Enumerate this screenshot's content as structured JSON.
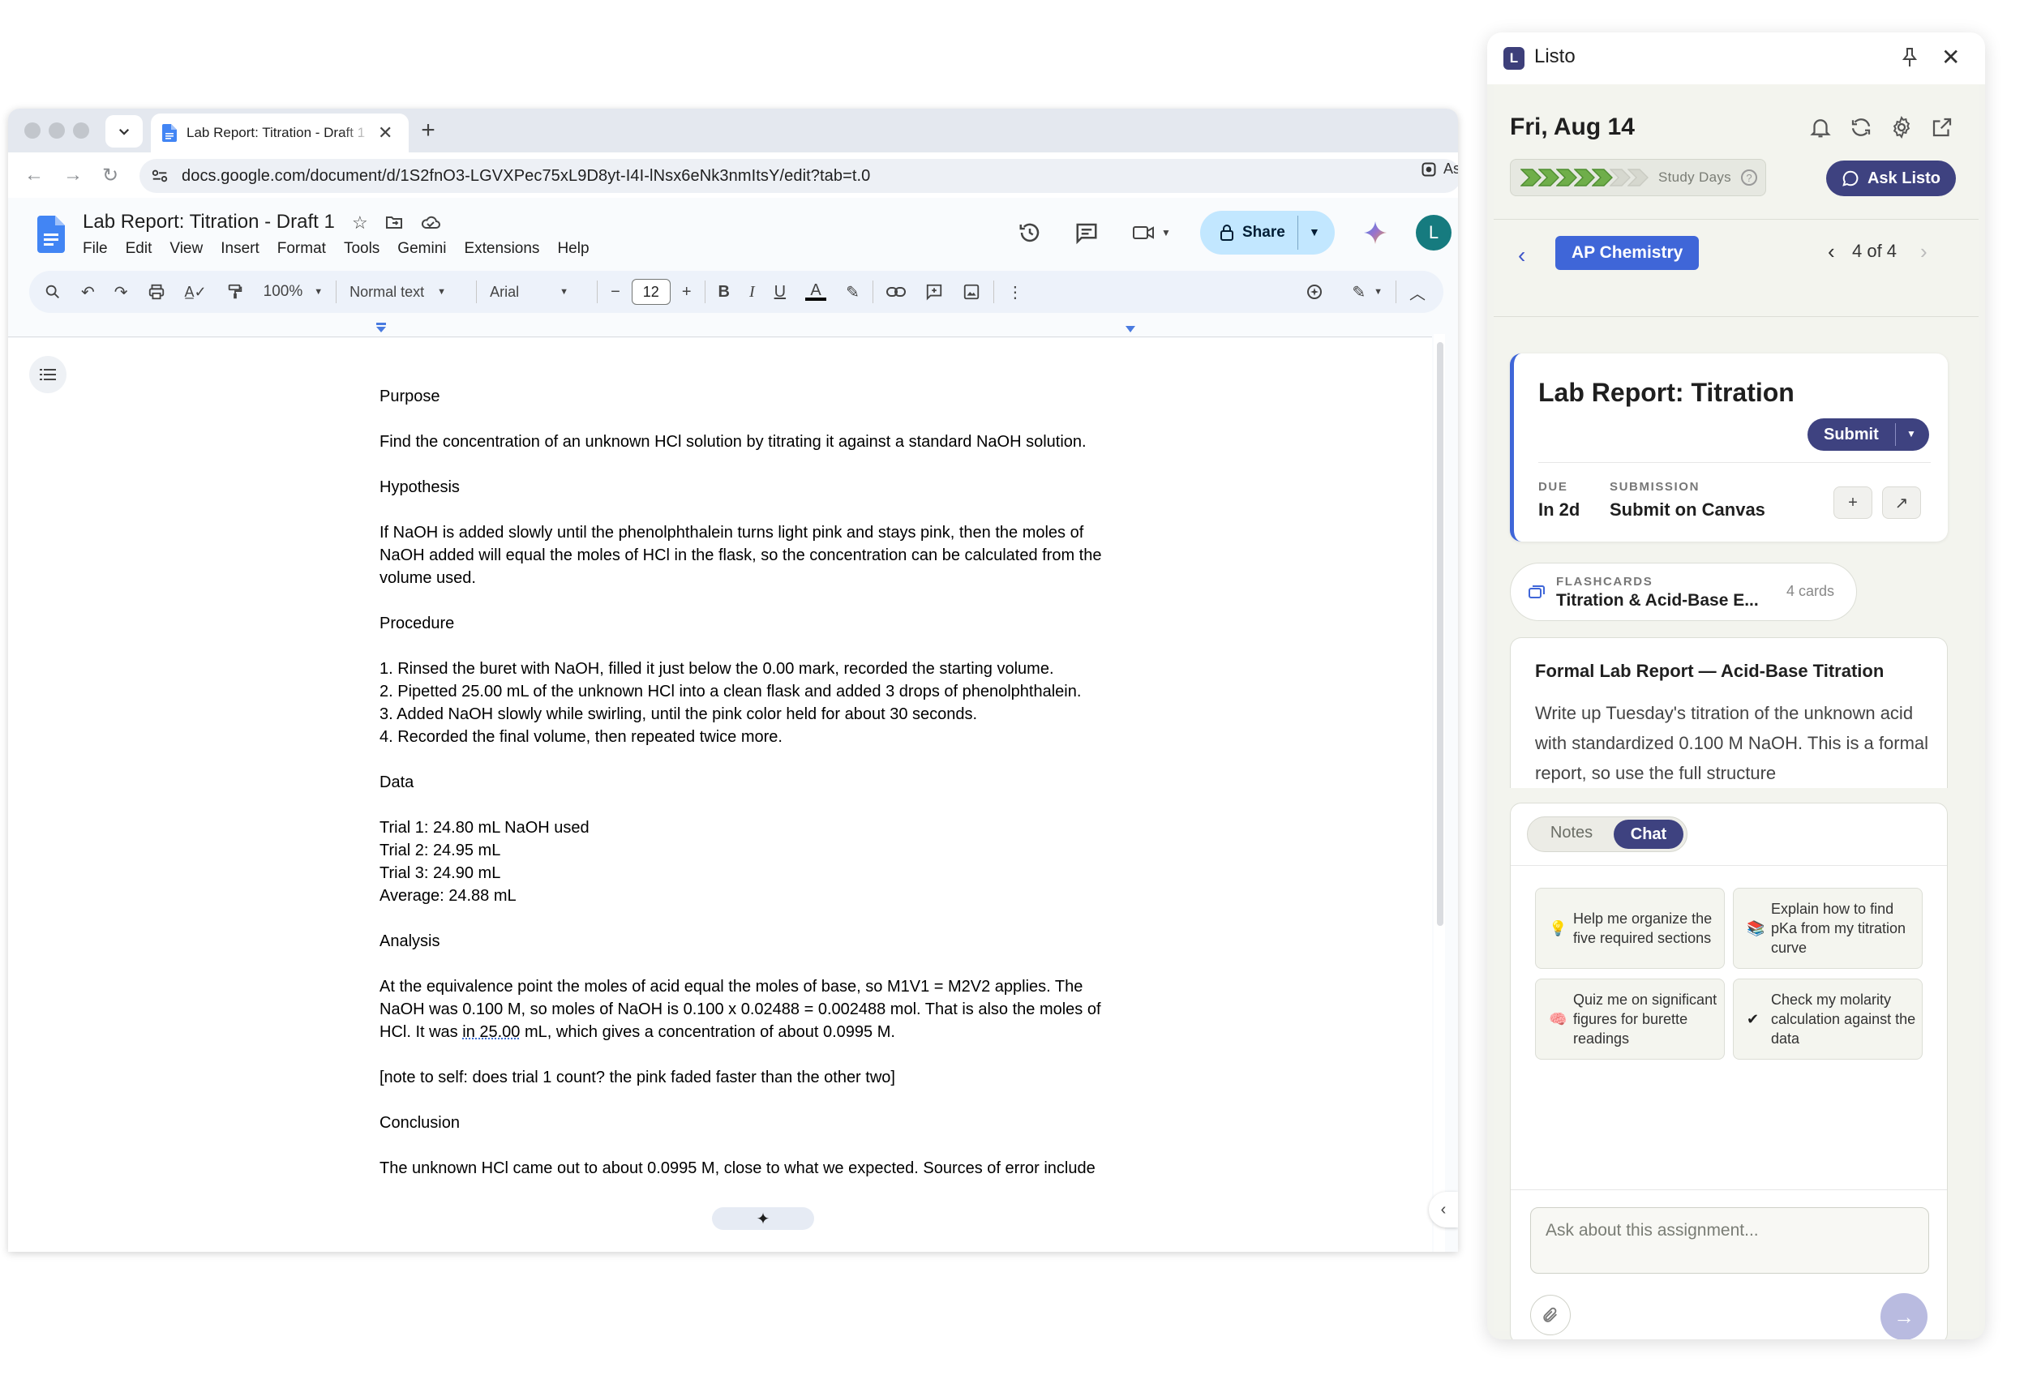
{
  "browser": {
    "tab_title": "Lab Report: Titration - Draft 1",
    "new_tab": "+",
    "url": "docs.google.com/document/d/1S2fnO3-LGVXPec75xL9D8yt-I4I-lNsx6eNk3nmItsY/edit?tab=t.0",
    "omnibox_extension": "As"
  },
  "docs": {
    "title": "Lab Report: Titration - Draft 1",
    "menu": [
      "File",
      "Edit",
      "View",
      "Insert",
      "Format",
      "Tools",
      "Gemini",
      "Extensions",
      "Help"
    ],
    "share_label": "Share",
    "avatar_letter": "L",
    "toolbar": {
      "zoom": "100%",
      "style": "Normal text",
      "font": "Arial",
      "font_size": "12"
    },
    "body": {
      "purpose_h": "Purpose",
      "purpose": "Find the concentration of an unknown HCl solution by titrating it against a standard NaOH solution.",
      "hypothesis_h": "Hypothesis",
      "hypothesis": "If NaOH is added slowly until the phenolphthalein turns light pink and stays pink, then the moles of NaOH added will equal the moles of HCl in the flask, so the concentration can be calculated from the volume used.",
      "procedure_h": "Procedure",
      "procedure": [
        "1. Rinsed the buret with NaOH, filled it just below the 0.00 mark, recorded the starting volume.",
        "2. Pipetted 25.00 mL of the unknown HCl into a clean flask and added 3 drops of phenolphthalein.",
        "3. Added NaOH slowly while swirling, until the pink color held for about 30 seconds.",
        "4. Recorded the final volume, then repeated twice more."
      ],
      "data_h": "Data",
      "data": [
        "Trial 1: 24.80 mL NaOH used",
        "Trial 2: 24.95 mL",
        "Trial 3: 24.90 mL",
        "Average: 24.88 mL"
      ],
      "analysis_h": "Analysis",
      "analysis_a": "At the equivalence point the moles of acid equal the moles of base, so M1V1 = M2V2 applies. The NaOH was 0.100 M, so moles of NaOH is 0.100 x 0.02488 = 0.002488 mol. That is also the moles of HCl. It was ",
      "analysis_underlined": "in 25.00",
      "analysis_b": " mL, which gives a concentration of about 0.0995 M.",
      "note": "[note to self: does trial 1 count? the pink faded faster than the other two]",
      "conclusion_h": "Conclusion",
      "conclusion": "The unknown HCl came out to about 0.0995 M, close to what we expected. Sources of error include"
    }
  },
  "listo": {
    "app_name": "Listo",
    "logo_letter": "L",
    "date": "Fri, Aug 14",
    "streak_label": "Study Days",
    "streak_filled": 5,
    "streak_total": 7,
    "help": "?",
    "ask_label": "Ask Listo",
    "course": "AP Chemistry",
    "position": "4 of 4",
    "assignment": {
      "title": "Lab Report: Titration",
      "submit_label": "Submit",
      "due_label": "DUE",
      "due_value": "In 2d",
      "submission_label": "SUBMISSION",
      "submission_value": "Submit on Canvas"
    },
    "flashcards": {
      "label": "FLASHCARDS",
      "title": "Titration & Acid-Base E...",
      "count": "4 cards"
    },
    "description": {
      "title": "Formal Lab Report — Acid-Base Titration",
      "text": "Write up Tuesday's titration of the unknown acid with standardized 0.100 M NaOH. This is a formal report, so use the full structure"
    },
    "chat": {
      "tab_notes": "Notes",
      "tab_chat": "Chat",
      "suggestions": [
        {
          "icon": "💡",
          "text": "Help me organize the five required sections"
        },
        {
          "icon": "📚",
          "text": "Explain how to find pKa from my titration curve"
        },
        {
          "icon": "🧠",
          "text": "Quiz me on significant figures for burette readings"
        },
        {
          "icon": "✔",
          "text": "Check my molarity calculation against the data"
        }
      ],
      "input_placeholder": "Ask about this assignment..."
    }
  }
}
